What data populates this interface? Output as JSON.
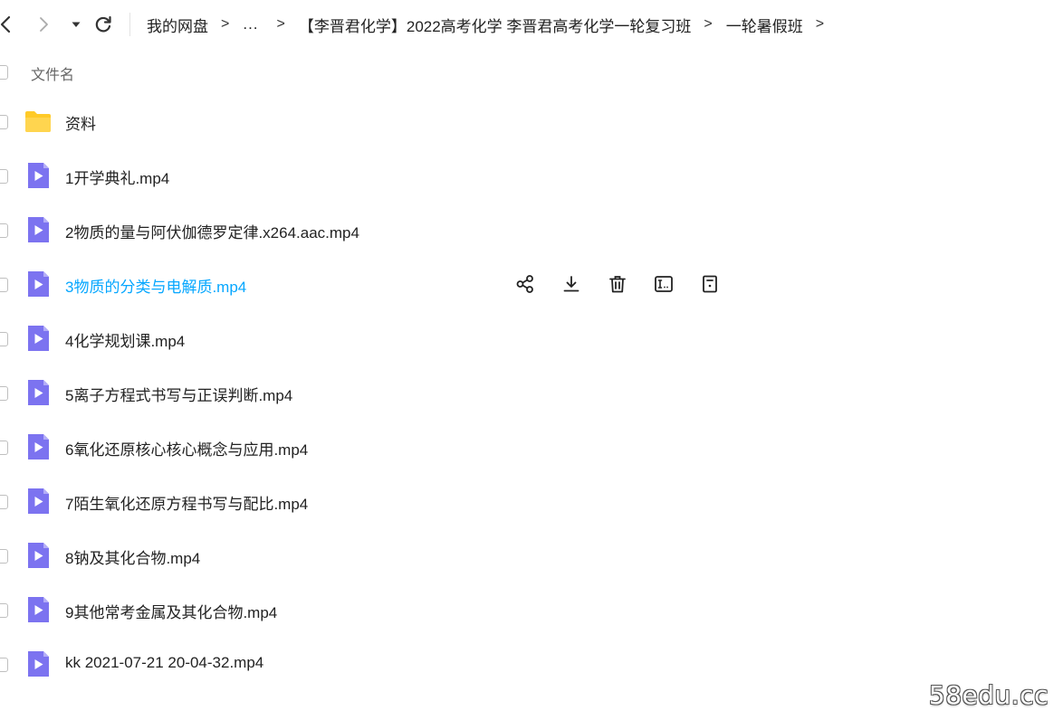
{
  "navbar": {
    "breadcrumb": {
      "root": "我的网盘",
      "separator": ">",
      "ellipsis": "...",
      "items": [
        "【李晋君化学】2022高考化学 李晋君高考化学一轮复习班",
        "一轮暑假班"
      ]
    }
  },
  "list_header": {
    "name_column": "文件名"
  },
  "files": [
    {
      "name": "资料",
      "type": "folder"
    },
    {
      "name": "1开学典礼.mp4",
      "type": "video"
    },
    {
      "name": "2物质的量与阿伏伽德罗定律.x264.aac.mp4",
      "type": "video"
    },
    {
      "name": "3物质的分类与电解质.mp4",
      "type": "video",
      "hovered": true
    },
    {
      "name": "4化学规划课.mp4",
      "type": "video"
    },
    {
      "name": "5离子方程式书写与正误判断.mp4",
      "type": "video"
    },
    {
      "name": "6氧化还原核心核心概念与应用.mp4",
      "type": "video"
    },
    {
      "name": "7陌生氧化还原方程书写与配比.mp4",
      "type": "video"
    },
    {
      "name": "8钠及其化合物.mp4",
      "type": "video"
    },
    {
      "name": "9其他常考金属及其化合物.mp4",
      "type": "video"
    },
    {
      "name": "kk 2021-07-21 20-04-32.mp4",
      "type": "video"
    }
  ],
  "row_actions": [
    "share-icon",
    "download-icon",
    "delete-icon",
    "rename-icon",
    "details-icon"
  ],
  "icons": {
    "folder": "folder-icon",
    "video": "video-file-icon"
  },
  "colors": {
    "hover_text": "#06a7ff",
    "folder": "#ffca28",
    "video_file": "#7c73f0"
  },
  "watermark": "58edu.cc"
}
